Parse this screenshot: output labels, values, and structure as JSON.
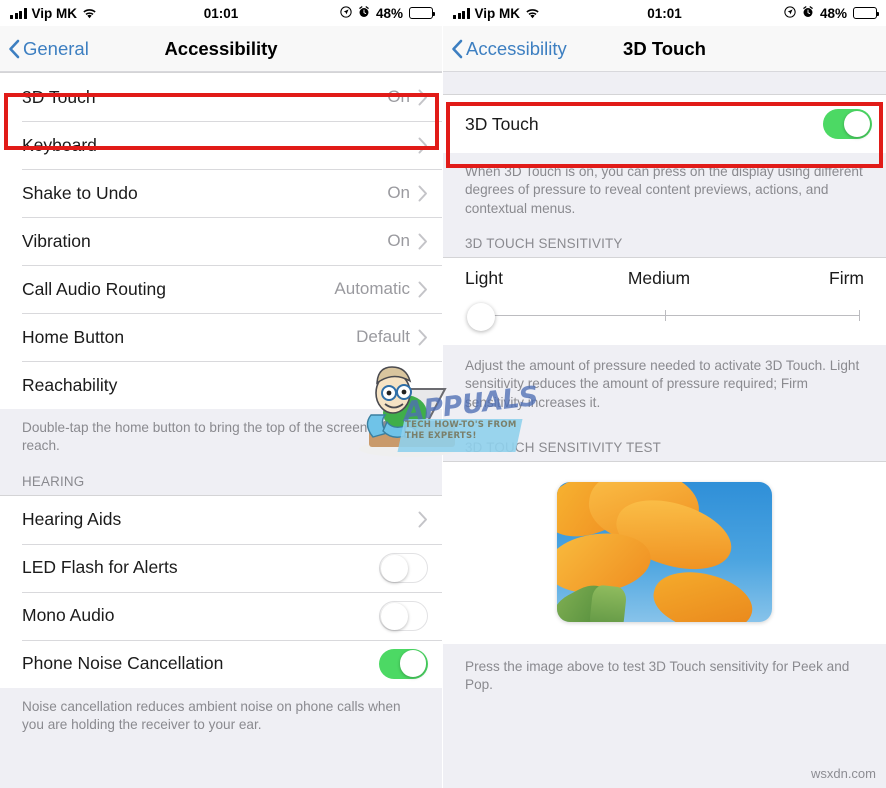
{
  "colors": {
    "ios_blue": "#3d7fc1",
    "switch_on_green": "#4CD964",
    "highlight_red": "#E11B18",
    "group_bg": "#EFEFF4",
    "secondary_text": "#8a8a8f"
  },
  "left_screen": {
    "statusbar": {
      "carrier": "Vip MK",
      "time": "01:01",
      "battery_percent": "48%",
      "signal_icon": "signal-bars-icon",
      "wifi_icon": "wifi-icon",
      "location_icon": "location-arrow-icon",
      "alarm_icon": "alarm-clock-icon",
      "battery_icon": "battery-icon"
    },
    "navbar": {
      "back_label": "General",
      "back_icon": "chevron-left-icon",
      "title": "Accessibility"
    },
    "interaction_group": {
      "rows": [
        {
          "label": "3D Touch",
          "value": "On",
          "accessory": "chevron",
          "highlighted": true
        },
        {
          "label": "Keyboard",
          "value": "",
          "accessory": "chevron",
          "highlighted": false
        },
        {
          "label": "Shake to Undo",
          "value": "On",
          "accessory": "chevron",
          "highlighted": false
        },
        {
          "label": "Vibration",
          "value": "On",
          "accessory": "chevron",
          "highlighted": false
        },
        {
          "label": "Call Audio Routing",
          "value": "Automatic",
          "accessory": "chevron",
          "highlighted": false
        },
        {
          "label": "Home Button",
          "value": "Default",
          "accessory": "chevron",
          "highlighted": false
        },
        {
          "label": "Reachability",
          "value": "",
          "accessory": "none",
          "highlighted": false
        }
      ],
      "footnote": "Double-tap the home button to bring the top of the screen into reach."
    },
    "hearing_group": {
      "header": "HEARING",
      "rows": [
        {
          "label": "Hearing Aids",
          "accessory": "chevron",
          "switch": null
        },
        {
          "label": "LED Flash for Alerts",
          "accessory": "switch",
          "switch": "off"
        },
        {
          "label": "Mono Audio",
          "accessory": "switch",
          "switch": "off"
        },
        {
          "label": "Phone Noise Cancellation",
          "accessory": "switch",
          "switch": "on"
        }
      ],
      "footnote": "Noise cancellation reduces ambient noise on phone calls when you are holding the receiver to your ear."
    }
  },
  "right_screen": {
    "statusbar": {
      "carrier": "Vip MK",
      "time": "01:01",
      "battery_percent": "48%",
      "signal_icon": "signal-bars-icon",
      "wifi_icon": "wifi-icon",
      "location_icon": "location-arrow-icon",
      "alarm_icon": "alarm-clock-icon",
      "battery_icon": "battery-icon"
    },
    "navbar": {
      "back_label": "Accessibility",
      "back_icon": "chevron-left-icon",
      "title": "3D Touch"
    },
    "toggle_row": {
      "label": "3D Touch",
      "switch": "on",
      "highlighted": true
    },
    "toggle_footnote": "When 3D Touch is on, you can press on the display using different degrees of pressure to reveal content previews, actions, and contextual menus.",
    "sensitivity": {
      "header": "3D TOUCH SENSITIVITY",
      "labels": {
        "min": "Light",
        "mid": "Medium",
        "max": "Firm"
      },
      "value": "Light",
      "position_percent": 0,
      "footnote": "Adjust the amount of pressure needed to activate 3D Touch. Light sensitivity reduces the amount of pressure required; Firm sensitivity increases it."
    },
    "sensitivity_test": {
      "header": "3D TOUCH SENSITIVITY TEST",
      "image_alt": "orange-poppy-flowers-blue-sky",
      "footnote": "Press the image above to test 3D Touch sensitivity for Peek and Pop."
    }
  },
  "watermarks": {
    "appuals_title": "APPUALS",
    "appuals_tagline": "TECH HOW-TO'S FROM THE EXPERTS!",
    "site": "wsxdn.com"
  }
}
